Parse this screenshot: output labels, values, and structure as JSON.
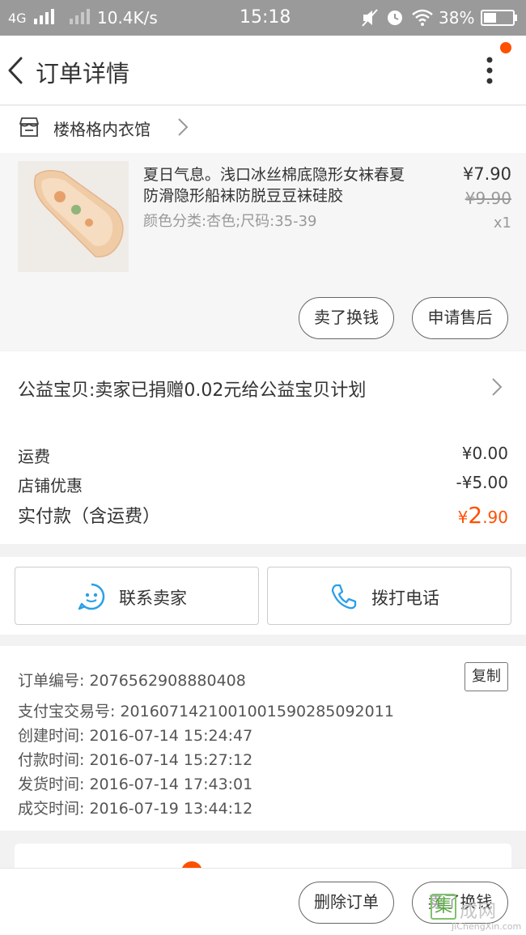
{
  "status_bar": {
    "network": "4G",
    "speed": "10.4K/s",
    "time": "15:18",
    "battery": "38%"
  },
  "header": {
    "title": "订单详情"
  },
  "shop": {
    "name": "楼格格内衣馆"
  },
  "product": {
    "name": "夏日气息。浅口冰丝棉底隐形女袜春夏防滑隐形船袜防脱豆豆袜硅胶",
    "sku": "颜色分类:杏色;尺码:35-39",
    "price": "¥7.90",
    "original_price": "¥9.90",
    "quantity": "x1",
    "sell_label": "卖了换钱",
    "aftersale_label": "申请售后"
  },
  "charity": {
    "text": "公益宝贝:卖家已捐赠0.02元给公益宝贝计划"
  },
  "fees": {
    "shipping_label": "运费",
    "shipping_value": "¥0.00",
    "discount_label": "店铺优惠",
    "discount_value": "-¥5.00",
    "total_label": "实付款（含运费）",
    "total_prefix": "¥",
    "total_int": "2",
    "total_dec": ".90"
  },
  "contact": {
    "seller_label": "联系卖家",
    "phone_label": "拨打电话"
  },
  "order_info": {
    "order_no": "订单编号: 2076562908880408",
    "alipay_no": "支付宝交易号: 2016071421001001590285092011",
    "created": "创建时间: 2016-07-14 15:24:47",
    "paid": "付款时间: 2016-07-14 15:27:12",
    "shipped": "发货时间: 2016-07-14 17:43:01",
    "completed": "成交时间: 2016-07-19 13:44:12",
    "copy_label": "复制"
  },
  "bottom_bar": {
    "delete_label": "删除订单",
    "sell_label": "卖了换钱"
  },
  "watermark": {
    "char": "集",
    "text": "成网",
    "url": "JiChengXin.com"
  },
  "colors": {
    "accent": "#ff5000",
    "status_bar": "#9a9a9a",
    "icon_blue": "#2aa0e8"
  }
}
